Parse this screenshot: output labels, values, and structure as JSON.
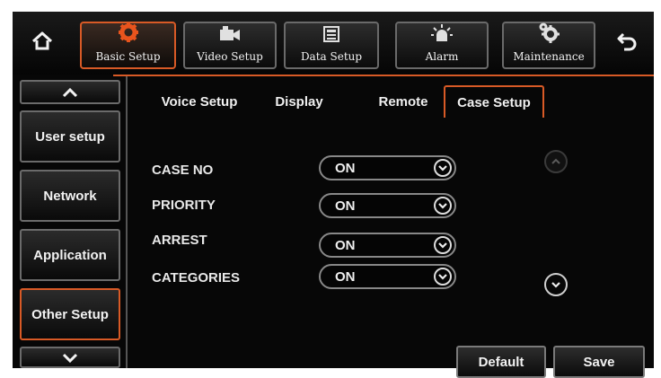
{
  "toolbar": {
    "home_icon": "home-icon",
    "back_icon": "back-arrow-icon",
    "buttons": [
      {
        "label": "Basic Setup",
        "icon": "gear-icon",
        "active": true
      },
      {
        "label": "Video Setup",
        "icon": "camera-icon",
        "active": false
      },
      {
        "label": "Data Setup",
        "icon": "data-icon",
        "active": false
      },
      {
        "label": "Alarm",
        "icon": "alarm-light-icon",
        "active": false
      },
      {
        "label": "Maintenance",
        "icon": "maintenance-gears-icon",
        "active": false
      }
    ],
    "accent_color": "#d85a26"
  },
  "sidebar": {
    "items": [
      {
        "label": "User setup"
      },
      {
        "label": "Network"
      },
      {
        "label": "Application"
      },
      {
        "label": "Other Setup",
        "active": true
      }
    ]
  },
  "tabs": [
    {
      "label": "Voice Setup"
    },
    {
      "label": "Display"
    },
    {
      "label": "Remote"
    },
    {
      "label": "Case Setup",
      "active": true
    }
  ],
  "settings": [
    {
      "label": "CASE NO",
      "value": "ON"
    },
    {
      "label": "PRIORITY",
      "value": "ON"
    },
    {
      "label": "ARREST",
      "value": "ON"
    },
    {
      "label": "CATEGORIES",
      "value": "ON"
    }
  ],
  "actions": {
    "default_label": "Default",
    "save_label": "Save"
  }
}
